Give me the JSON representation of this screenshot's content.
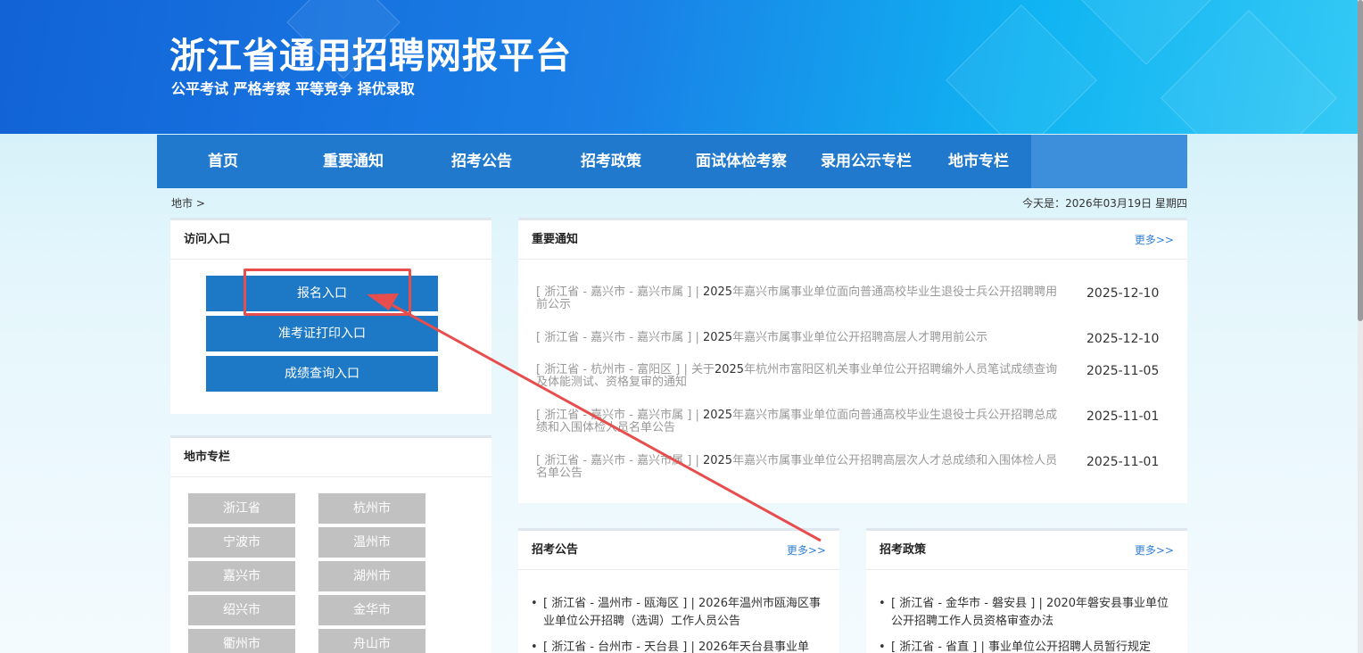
{
  "banner": {
    "title": "浙江省通用招聘网报平台",
    "slogan": "公平考试 严格考察 平等竞争 择优录取"
  },
  "nav": [
    "首页",
    "重要通知",
    "招考公告",
    "招考政策",
    "面试体检考察",
    "录用公示专栏",
    "地市专栏"
  ],
  "breadcrumb": "地市 >",
  "today": "今天是：2026年03月19日 星期四",
  "access": {
    "title": "访问入口",
    "buttons": [
      "报名入口",
      "准考证打印入口",
      "成绩查询入口"
    ]
  },
  "cities": {
    "title": "地市专栏",
    "items": [
      "浙江省",
      "杭州市",
      "宁波市",
      "温州市",
      "嘉兴市",
      "湖州市",
      "绍兴市",
      "金华市",
      "衢州市",
      "舟山市"
    ]
  },
  "notices": {
    "title": "重要通知",
    "more": "更多>>",
    "items": [
      {
        "region": "[ 浙江省 - 嘉兴市 - 嘉兴市属 ] | ",
        "year": "2025",
        "text": "年嘉兴市属事业单位面向普通高校毕业生退役士兵公开招聘聘用前公示",
        "date": "2025-12-10"
      },
      {
        "region": "[ 浙江省 - 嘉兴市 - 嘉兴市属 ] | ",
        "year": "2025",
        "text": "年嘉兴市属事业单位公开招聘高层人才聘用前公示",
        "date": "2025-12-10"
      },
      {
        "region": "[ 浙江省 - 杭州市 - 富阳区 ] | 关于",
        "year": "2025",
        "text": "年杭州市富阳区机关事业单位公开招聘编外人员笔试成绩查询及体能测试、资格复审的通知",
        "date": "2025-11-05"
      },
      {
        "region": "[ 浙江省 - 嘉兴市 - 嘉兴市属 ] | ",
        "year": "2025",
        "text": "年嘉兴市属事业单位面向普通高校毕业生退役士兵公开招聘总成绩和入围体检人员名单公告",
        "date": "2025-11-01"
      },
      {
        "region": "[ 浙江省 - 嘉兴市 - 嘉兴市属 ] | ",
        "year": "2025",
        "text": "年嘉兴市属事业单位公开招聘高层次人才总成绩和入围体检人员名单公告",
        "date": "2025-11-01"
      }
    ]
  },
  "announcements": {
    "title": "招考公告",
    "more": "更多>>",
    "items": [
      "[ 浙江省 - 温州市 - 瓯海区 ] | 2026年温州市瓯海区事业单位公开招聘（选调）工作人员公告",
      "[ 浙江省 - 台州市 - 天台县 ] | 2026年天台县事业单"
    ]
  },
  "policies": {
    "title": "招考政策",
    "more": "更多>>",
    "items": [
      "[ 浙江省 - 金华市 - 磐安县 ] | 2020年磐安县事业单位公开招聘工作人员资格审查办法",
      "[ 浙江省 - 省直 ] | 事业单位公开招聘人员暂行规定"
    ]
  },
  "colors": {
    "nav_bg": "#2079cc",
    "entry_button": "#1d79c6",
    "city_button": "#c1c1c1",
    "annotation": "#e84d4d",
    "link": "#2f7fd8"
  }
}
